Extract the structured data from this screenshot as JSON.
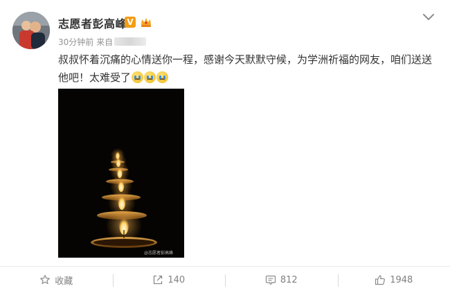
{
  "post": {
    "author": "志愿者彭高峰",
    "verified_badge": "V",
    "time": "30分钟前",
    "source_label": "来自",
    "text": "叔叔怀着沉痛的心情送你一程，感谢今天默默守候，为学洲祈福的网友，咱们送送他吧！太难受了",
    "image_watermark": "@志愿者彭高峰",
    "emoji": [
      "crying-face-icon",
      "crying-face-icon",
      "crying-face-icon"
    ]
  },
  "actions": [
    {
      "label": "收藏",
      "icon": "star-icon"
    },
    {
      "label": "140",
      "icon": "share-icon"
    },
    {
      "label": "812",
      "icon": "comment-icon"
    },
    {
      "label": "1948",
      "icon": "thumbs-up-icon"
    }
  ],
  "colors": {
    "text": "#333333",
    "meta": "#939393",
    "badge": "#f39c12"
  }
}
